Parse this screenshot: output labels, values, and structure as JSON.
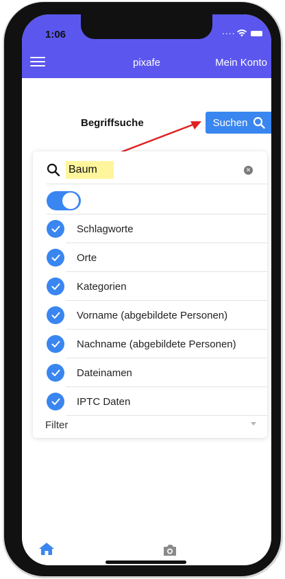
{
  "status_bar": {
    "time": "1:06",
    "signal_dots": "...."
  },
  "navbar": {
    "title": "pixafe",
    "account_label": "Mein Konto"
  },
  "search": {
    "title": "Begriffsuche",
    "button_label": "Suchen",
    "query": "Baum",
    "toggle_on": true
  },
  "options": [
    {
      "label": "Schlagworte",
      "checked": true
    },
    {
      "label": "Orte",
      "checked": true
    },
    {
      "label": "Kategorien",
      "checked": true
    },
    {
      "label": "Vorname (abgebildete Personen)",
      "checked": true
    },
    {
      "label": "Nachname (abgebildete Personen)",
      "checked": true
    },
    {
      "label": "Dateinamen",
      "checked": true
    },
    {
      "label": "IPTC Daten",
      "checked": true
    }
  ],
  "filter": {
    "label": "Filter"
  },
  "tab_bar": {
    "home_icon": "home-icon",
    "camera_icon": "camera-icon"
  },
  "colors": {
    "accent": "#3a86f0",
    "navbar": "#5b57ee",
    "highlight": "#fff59c",
    "annotation_arrow": "#e02020"
  }
}
